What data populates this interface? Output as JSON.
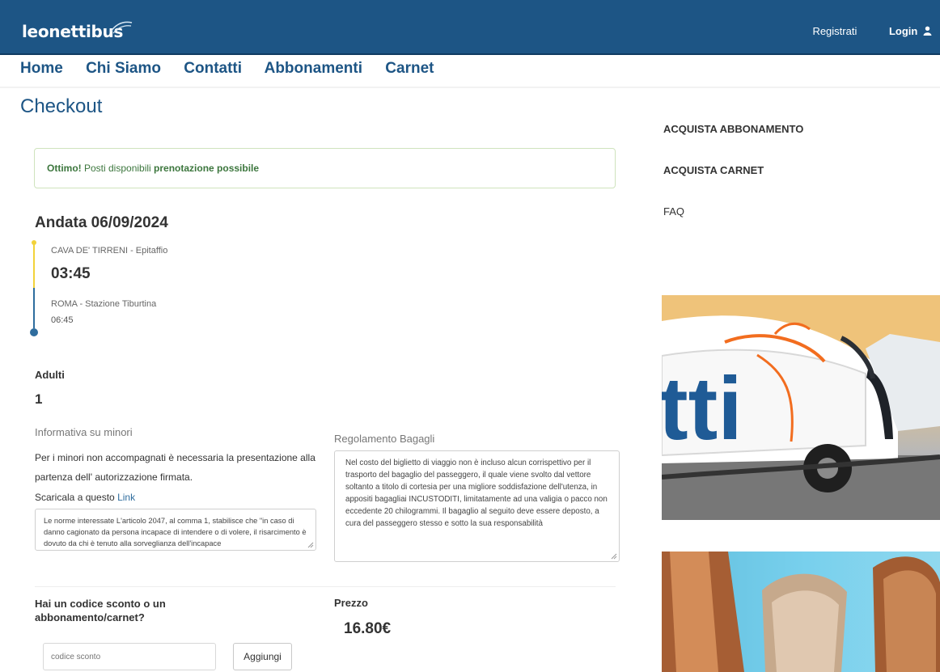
{
  "brand": {
    "logo_text": "leonettibus"
  },
  "topbar": {
    "register_label": "Registrati",
    "login_label": "Login"
  },
  "nav": {
    "items": [
      "Home",
      "Chi Siamo",
      "Contatti",
      "Abbonamenti",
      "Carnet"
    ]
  },
  "page": {
    "title": "Checkout"
  },
  "sidebar": {
    "links": [
      "ACQUISTA ABBONAMENTO",
      "ACQUISTA CARNET",
      "FAQ"
    ],
    "photo_text": "tti"
  },
  "alert": {
    "bold_intro": "Ottimo!",
    "text": " Posti disponibili ",
    "bold_outro": "prenotazione possibile"
  },
  "trip": {
    "title": "Andata 06/09/2024",
    "departure_stop": "CAVA DE' TIRRENI - Epitaffio",
    "departure_time": "03:45",
    "arrival_stop": "ROMA - Stazione Tiburtina",
    "arrival_time": "06:45"
  },
  "passengers": {
    "label": "Adulti",
    "value": "1"
  },
  "minors": {
    "title": "Informativa su minori",
    "text": "Per i minori non accompagnati è necessaria la presentazione alla partenza dell' autorizzazione firmata.",
    "download_prefix": "Scaricala a questo ",
    "link_label": "Link",
    "textarea_text": "Le norme interessate L'articolo 2047, al comma 1, stabilisce che \"in caso di danno cagionato da persona incapace di intendere o di volere, il risarcimento è dovuto da chi è tenuto alla sorveglianza dell'incapace"
  },
  "baggage": {
    "title": "Regolamento Bagagli",
    "text": "Nel costo del biglietto di viaggio non è incluso alcun corrispettivo per il trasporto del bagaglio del passeggero, il quale viene svolto dal vettore soltanto a titolo di cortesia per una migliore soddisfazione dell'utenza, in appositi bagagliai INCUSTODITI, limitatamente ad una valigia o pacco non eccedente 20 chilogrammi. Il bagaglio al seguito deve essere deposto, a cura del passeggero stesso e sotto la sua responsabilità"
  },
  "discount": {
    "label": "Hai un codice sconto o un abbonamento/carnet?",
    "placeholder": "codice sconto",
    "add_label": "Aggiungi"
  },
  "price": {
    "label": "Prezzo",
    "value": "16.80€"
  },
  "colors": {
    "primary": "#1d5585",
    "success": "#3c763d",
    "timeline_start": "#f2d23a",
    "timeline_end": "#2f6d9e"
  }
}
